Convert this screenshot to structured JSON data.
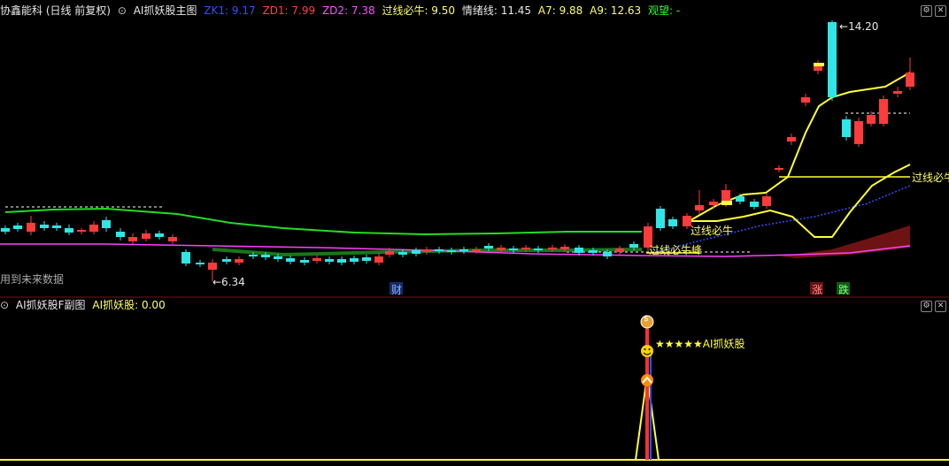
{
  "main_header": {
    "stock": "协鑫能科 (日线 前复权)",
    "indicator": "AI抓妖股主图",
    "zk1": "ZK1: 9.17",
    "zd1": "ZD1: 7.99",
    "zd2": "ZD2: 7.38",
    "guoxian": "过线必牛: 9.50",
    "qingxu": "情绪线: 11.45",
    "a7": "A7: 9.88",
    "a9": "A9: 12.63",
    "guanwang": "观望: -"
  },
  "sub_header": {
    "indicator": "AI抓妖股F副图",
    "value": "AI抓妖股: 0.00"
  },
  "labels": {
    "high_price": "14.20",
    "low_price": "←6.34",
    "future_data": "用到未来数据",
    "guoxian_right": "过线必牛",
    "guoxian_mid": "过线必牛",
    "overlap_text": "过线必牛峰",
    "cai": "财",
    "zhang": "涨",
    "die": "跌",
    "stars": "★★★★★AI抓妖股",
    "dollar": "$"
  },
  "colors": {
    "up": "#ff3b3b",
    "down": "#2ee6e6",
    "yellow": "#ffff3c",
    "green": "#22dd22",
    "blue": "#3050ff",
    "magenta": "#ff40ff",
    "label_blue": "#5a9cff",
    "zd1_red": "#ff4040",
    "zd2_magenta": "#ff50ff",
    "text_white": "#e8e8e8",
    "text_yellow": "#ffff66",
    "text_green": "#33ff33",
    "grid_red": "#7a1010"
  },
  "icons": {
    "collapse": "circle-chevron-icon",
    "settings": "gear-icon",
    "close": "close-icon"
  }
}
